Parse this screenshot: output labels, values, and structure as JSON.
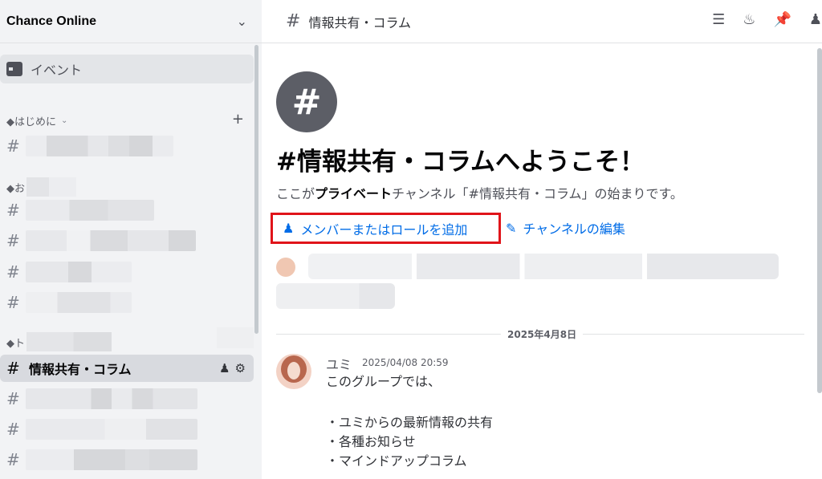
{
  "server": {
    "name": "Chance Online"
  },
  "sidebar": {
    "events_label": "イベント",
    "category_1": "◆はじめに",
    "category_2": "◆お",
    "category_3": "◆ト",
    "active_channel": "情報共有・コラム"
  },
  "header": {
    "channel_name": "情報共有・コラム",
    "hash": "#"
  },
  "welcome": {
    "icon": "#",
    "title": "#情報共有・コラムへようこそ！",
    "sub_prefix": "ここが",
    "sub_bold": "プライベート",
    "sub_suffix": "チャンネル「#情報共有・コラム」の始まりです。",
    "add_member": "メンバーまたはロールを追加",
    "edit_channel": "チャンネルの編集"
  },
  "date_divider": "2025年4月8日",
  "message": {
    "author": "ユミ",
    "timestamp": "2025/04/08 20:59",
    "lines": [
      "このグループでは、",
      "・ユミからの最新情報の共有",
      "・各種お知らせ",
      "・マインドアップコラム"
    ]
  },
  "colors": {
    "accent": "#006ce7",
    "highlight": "#e0141a"
  }
}
